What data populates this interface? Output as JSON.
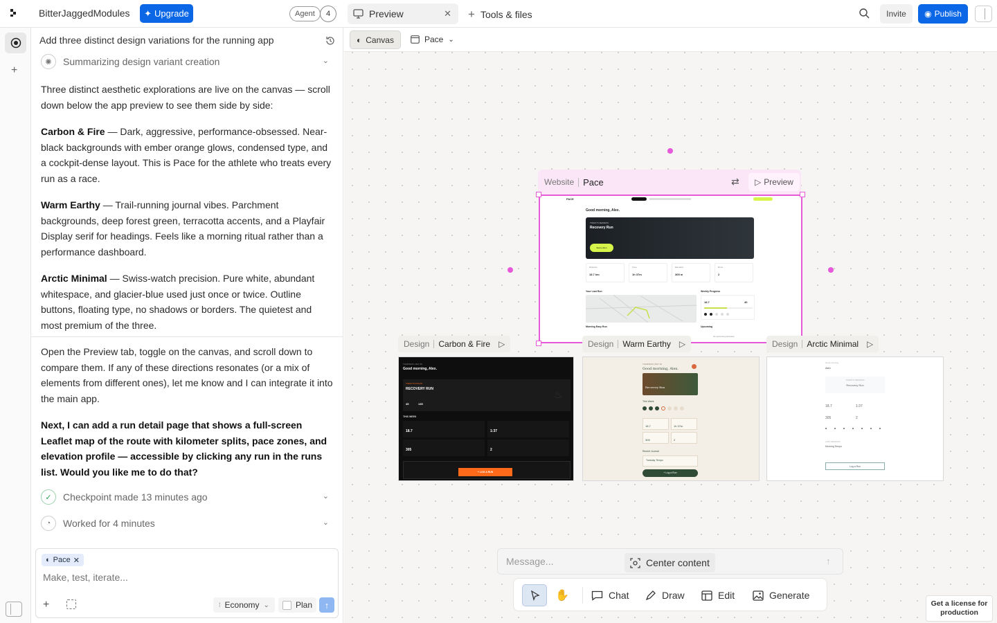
{
  "topbar": {
    "project_name": "BitterJaggedModules",
    "upgrade_label": "Upgrade",
    "agent_label": "Agent",
    "agent_count": "4",
    "tab_preview": "Preview",
    "tab_tools": "Tools & files",
    "invite_label": "Invite",
    "publish_label": "Publish"
  },
  "chat": {
    "header": "Add three distinct design variations for the running app",
    "summary_step": "Summarizing design variant creation",
    "intro": "Three distinct aesthetic explorations are live on the canvas — scroll down below the app preview to see them side by side:",
    "variants": [
      {
        "name": "Carbon & Fire",
        "desc": " — Dark, aggressive, performance-obsessed. Near-black backgrounds with ember orange glows, condensed type, and a cockpit-dense layout. This is Pace for the athlete who treats every run as a race."
      },
      {
        "name": "Warm Earthy",
        "desc": " — Trail-running journal vibes. Parchment backgrounds, deep forest green, terracotta accents, and a Playfair Display serif for headings. Feels like a morning ritual rather than a performance dashboard."
      },
      {
        "name": "Arctic Minimal",
        "desc": " — Swiss-watch precision. Pure white, abundant whitespace, and glacier-blue used just once or twice. Outline buttons, floating type, no shadows or borders. The quietest and most premium of the three."
      }
    ],
    "instructions": "Open the Preview tab, toggle on the canvas, and scroll down to compare them. If any of these directions resonates (or a mix of elements from different ones), let me know and I can integrate it into the main app.",
    "followup": "Next, I can add a run detail page that shows a full-screen Leaflet map of the route with kilometer splits, pace zones, and elevation profile — accessible by clicking any run in the runs list. Would you like me to do that?",
    "checkpoint": "Checkpoint made 13 minutes ago",
    "worked": "Worked for 4 minutes"
  },
  "composer": {
    "chip": "Pace",
    "placeholder": "Make, test, iterate...",
    "mode": "Economy",
    "plan_label": "Plan"
  },
  "canvas": {
    "canvas_btn": "Canvas",
    "page_name": "Pace",
    "website_type": "Website",
    "website_name": "Pace",
    "preview_label": "Preview",
    "design_type": "Design",
    "designs": [
      "Carbon & Fire",
      "Warm Earthy",
      "Arctic Minimal"
    ],
    "message_placeholder": "Message...",
    "center_content": "Center content",
    "tools": {
      "chat": "Chat",
      "draw": "Draw",
      "edit": "Edit",
      "generate": "Generate"
    },
    "license": "Get a license for production"
  },
  "site_preview": {
    "brand": "PACE",
    "greeting": "Good morning, Alex.",
    "hero_kicker": "TODAY'S SESSION",
    "hero_title": "Recovery Run",
    "hero_button": "Start a Run",
    "stats": [
      {
        "label": "Distance",
        "value": "18.7 km"
      },
      {
        "label": "Time",
        "value": "1h 37m"
      },
      {
        "label": "Elevation",
        "value": "305 m"
      },
      {
        "label": "Runs",
        "value": "2"
      }
    ],
    "last_run": "Your Last Run",
    "weekly": "Weekly Progress",
    "weekly_value": "18.7",
    "weekly_goal": "40",
    "run_name": "Morning Easy Run",
    "upcoming": "Upcoming",
    "no_upcoming": "No upcoming workouts",
    "log_run": "Log a Run"
  },
  "carbon": {
    "date": "THURSDAY, MAY 30",
    "greeting": "Good morning, Alex.",
    "kicker": "TODAY'S FOCUS",
    "title": "RECOVERY RUN",
    "stat1": "45",
    "stat2": "135",
    "week": "THIS WEEK",
    "v1": "18.7",
    "v2": "1:37",
    "v3": "305",
    "v4": "2",
    "cta": "+ LOG A RUN",
    "accent": "#ff6a1a"
  },
  "warm": {
    "date": "THURSDAY, MAY 30",
    "greeting": "Good morning, Alex.",
    "hero_title": "Recovery Run",
    "week": "This Week",
    "v1": "18.7",
    "v2": "1h 37m",
    "v3": "305",
    "v4": "2",
    "journal": "Recent Journal",
    "entry": "Tuesday Tempo",
    "cta": "+ Log a Run",
    "green": "#2f4a35",
    "terracotta": "#d9683e"
  },
  "arctic": {
    "date": "Good morning",
    "name": "Alex",
    "today": "TODAY'S SESSION",
    "session": "Recovery Run",
    "v1": "18.7",
    "v2": "1:37",
    "v3": "305",
    "v4": "2",
    "last": "LAST SESSION",
    "run": "Morning Tempo",
    "cta": "Log a Run"
  }
}
